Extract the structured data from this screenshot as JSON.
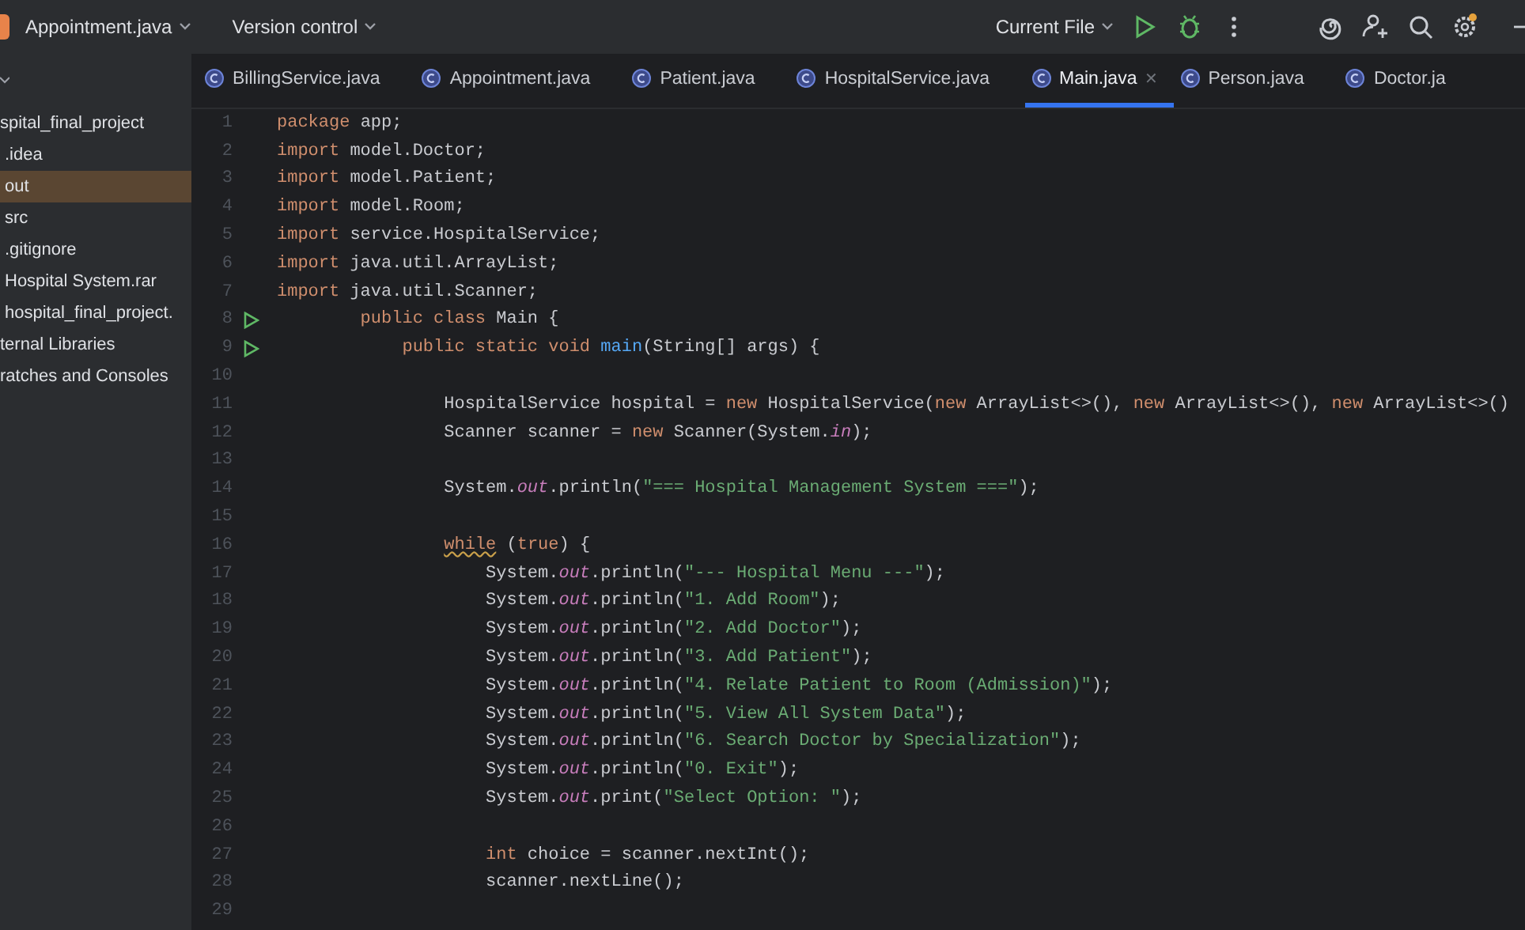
{
  "toolbar": {
    "file_menu": "Appointment.java",
    "vcs_menu": "Version control",
    "run_config": "Current File"
  },
  "project_tree": {
    "items": [
      {
        "label": "spital_final_project",
        "selected": false,
        "children": [
          {
            "label": ".idea",
            "selected": false
          },
          {
            "label": "out",
            "selected": true
          },
          {
            "label": "src",
            "selected": false
          },
          {
            "label": ".gitignore",
            "selected": false
          },
          {
            "label": "Hospital System.rar",
            "selected": false
          },
          {
            "label": "hospital_final_project.",
            "selected": false
          }
        ]
      },
      {
        "label": "ternal Libraries",
        "selected": false
      },
      {
        "label": "ratches and Consoles",
        "selected": false
      }
    ]
  },
  "tabs": [
    {
      "label": "BillingService.java",
      "selected": false
    },
    {
      "label": "Appointment.java",
      "selected": false
    },
    {
      "label": "Patient.java",
      "selected": false
    },
    {
      "label": "HospitalService.java",
      "selected": false
    },
    {
      "label": "Main.java",
      "selected": true,
      "close": "✕"
    },
    {
      "label": "Person.java",
      "selected": false
    },
    {
      "label": "Doctor.ja",
      "selected": false
    }
  ],
  "code_lines": [
    {
      "number": "1",
      "run": false,
      "tokens": [
        {
          "kind": "keyword",
          "text": "package"
        },
        {
          "kind": "plain",
          "text": " app;"
        }
      ]
    },
    {
      "number": "2",
      "run": false,
      "tokens": [
        {
          "kind": "keyword",
          "text": "import"
        },
        {
          "kind": "plain",
          "text": " model.Doctor;"
        }
      ]
    },
    {
      "number": "3",
      "run": false,
      "tokens": [
        {
          "kind": "keyword",
          "text": "import"
        },
        {
          "kind": "plain",
          "text": " model.Patient;"
        }
      ]
    },
    {
      "number": "4",
      "run": false,
      "tokens": [
        {
          "kind": "keyword",
          "text": "import"
        },
        {
          "kind": "plain",
          "text": " model.Room;"
        }
      ]
    },
    {
      "number": "5",
      "run": false,
      "tokens": [
        {
          "kind": "keyword",
          "text": "import"
        },
        {
          "kind": "plain",
          "text": " service.HospitalService;"
        }
      ]
    },
    {
      "number": "6",
      "run": false,
      "tokens": [
        {
          "kind": "keyword",
          "text": "import"
        },
        {
          "kind": "plain",
          "text": " java.util.ArrayList;"
        }
      ]
    },
    {
      "number": "7",
      "run": false,
      "tokens": [
        {
          "kind": "keyword",
          "text": "import"
        },
        {
          "kind": "plain",
          "text": " java.util.Scanner;"
        }
      ]
    },
    {
      "number": "8",
      "run": true,
      "tokens": [
        {
          "kind": "keyword",
          "text": "        public class"
        },
        {
          "kind": "plain",
          "text": " Main {"
        }
      ]
    },
    {
      "number": "9",
      "run": true,
      "tokens": [
        {
          "kind": "keyword",
          "text": "            public static void"
        },
        {
          "kind": "method",
          "text": " main"
        },
        {
          "kind": "plain",
          "text": "(String[] args) {"
        }
      ]
    },
    {
      "number": "10",
      "run": false
    },
    {
      "number": "11",
      "run": false,
      "tokens": [
        {
          "kind": "plain",
          "text": "                HospitalService hospital = "
        },
        {
          "kind": "keyword",
          "text": "new"
        },
        {
          "kind": "plain",
          "text": " HospitalService("
        },
        {
          "kind": "keyword",
          "text": "new"
        },
        {
          "kind": "plain",
          "text": " ArrayList<>(), "
        },
        {
          "kind": "keyword",
          "text": "new"
        },
        {
          "kind": "plain",
          "text": " ArrayList<>(), "
        },
        {
          "kind": "keyword",
          "text": "new"
        },
        {
          "kind": "plain",
          "text": " ArrayList<>()"
        }
      ]
    },
    {
      "number": "12",
      "run": false,
      "tokens": [
        {
          "kind": "plain",
          "text": "                Scanner scanner = "
        },
        {
          "kind": "keyword",
          "text": "new"
        },
        {
          "kind": "plain",
          "text": " Scanner(System."
        },
        {
          "kind": "field",
          "text": "in"
        },
        {
          "kind": "plain",
          "text": ");"
        }
      ]
    },
    {
      "number": "13",
      "run": false
    },
    {
      "number": "14",
      "run": false,
      "tokens": [
        {
          "kind": "plain",
          "text": "                System."
        },
        {
          "kind": "field",
          "text": "out"
        },
        {
          "kind": "plain",
          "text": ".println("
        },
        {
          "kind": "string",
          "text": "\"=== Hospital Management System ===\""
        },
        {
          "kind": "plain",
          "text": ");"
        }
      ]
    },
    {
      "number": "15",
      "run": false
    },
    {
      "number": "16",
      "run": false,
      "tokens": [
        {
          "kind": "warning_keyword",
          "text": "                while"
        },
        {
          "kind": "plain",
          "text": " ("
        },
        {
          "kind": "keyword",
          "text": "true"
        },
        {
          "kind": "plain",
          "text": ") {"
        }
      ]
    },
    {
      "number": "17",
      "run": false,
      "tokens": [
        {
          "kind": "plain",
          "text": "                    System."
        },
        {
          "kind": "field",
          "text": "out"
        },
        {
          "kind": "plain",
          "text": ".println("
        },
        {
          "kind": "string",
          "text": "\"--- Hospital Menu ---\""
        },
        {
          "kind": "plain",
          "text": ");"
        }
      ]
    },
    {
      "number": "18",
      "run": false,
      "tokens": [
        {
          "kind": "plain",
          "text": "                    System."
        },
        {
          "kind": "field",
          "text": "out"
        },
        {
          "kind": "plain",
          "text": ".println("
        },
        {
          "kind": "string",
          "text": "\"1. Add Room\""
        },
        {
          "kind": "plain",
          "text": ");"
        }
      ]
    },
    {
      "number": "19",
      "run": false,
      "tokens": [
        {
          "kind": "plain",
          "text": "                    System."
        },
        {
          "kind": "field",
          "text": "out"
        },
        {
          "kind": "plain",
          "text": ".println("
        },
        {
          "kind": "string",
          "text": "\"2. Add Doctor\""
        },
        {
          "kind": "plain",
          "text": ");"
        }
      ]
    },
    {
      "number": "20",
      "run": false,
      "tokens": [
        {
          "kind": "plain",
          "text": "                    System."
        },
        {
          "kind": "field",
          "text": "out"
        },
        {
          "kind": "plain",
          "text": ".println("
        },
        {
          "kind": "string",
          "text": "\"3. Add Patient\""
        },
        {
          "kind": "plain",
          "text": ");"
        }
      ]
    },
    {
      "number": "21",
      "run": false,
      "tokens": [
        {
          "kind": "plain",
          "text": "                    System."
        },
        {
          "kind": "field",
          "text": "out"
        },
        {
          "kind": "plain",
          "text": ".println("
        },
        {
          "kind": "string",
          "text": "\"4. Relate Patient to Room (Admission)\""
        },
        {
          "kind": "plain",
          "text": ");"
        }
      ]
    },
    {
      "number": "22",
      "run": false,
      "tokens": [
        {
          "kind": "plain",
          "text": "                    System."
        },
        {
          "kind": "field",
          "text": "out"
        },
        {
          "kind": "plain",
          "text": ".println("
        },
        {
          "kind": "string",
          "text": "\"5. View All System Data\""
        },
        {
          "kind": "plain",
          "text": ");"
        }
      ]
    },
    {
      "number": "23",
      "run": false,
      "tokens": [
        {
          "kind": "plain",
          "text": "                    System."
        },
        {
          "kind": "field",
          "text": "out"
        },
        {
          "kind": "plain",
          "text": ".println("
        },
        {
          "kind": "string",
          "text": "\"6. Search Doctor by Specialization\""
        },
        {
          "kind": "plain",
          "text": ");"
        }
      ]
    },
    {
      "number": "24",
      "run": false,
      "tokens": [
        {
          "kind": "plain",
          "text": "                    System."
        },
        {
          "kind": "field",
          "text": "out"
        },
        {
          "kind": "plain",
          "text": ".println("
        },
        {
          "kind": "string",
          "text": "\"0. Exit\""
        },
        {
          "kind": "plain",
          "text": ");"
        }
      ]
    },
    {
      "number": "25",
      "run": false,
      "tokens": [
        {
          "kind": "plain",
          "text": "                    System."
        },
        {
          "kind": "field",
          "text": "out"
        },
        {
          "kind": "plain",
          "text": ".print("
        },
        {
          "kind": "string",
          "text": "\"Select Option: \""
        },
        {
          "kind": "plain",
          "text": ");"
        }
      ]
    },
    {
      "number": "26",
      "run": false
    },
    {
      "number": "27",
      "run": false,
      "tokens": [
        {
          "kind": "keyword",
          "text": "                    int"
        },
        {
          "kind": "plain",
          "text": " choice = scanner.nextInt();"
        }
      ]
    },
    {
      "number": "28",
      "run": false,
      "tokens": [
        {
          "kind": "plain",
          "text": "                    scanner.nextLine();"
        }
      ]
    },
    {
      "number": "29",
      "run": false
    }
  ]
}
